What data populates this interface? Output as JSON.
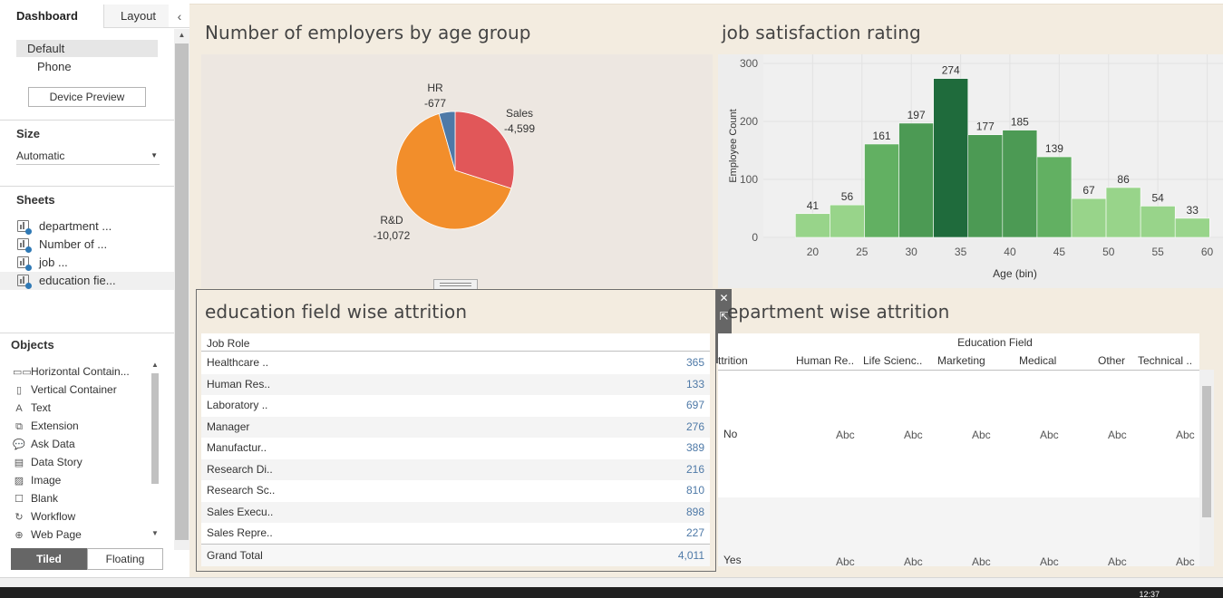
{
  "left_panel": {
    "tabs": [
      "Dashboard",
      "Layout"
    ],
    "collapse_glyph": "‹",
    "devices": {
      "default": "Default",
      "phone": "Phone",
      "preview_button": "Device Preview"
    },
    "size": {
      "title": "Size",
      "value": "Automatic"
    },
    "sheets": {
      "title": "Sheets",
      "items": [
        "department ...",
        "Number of ...",
        "job ...",
        "education fie..."
      ]
    },
    "objects": {
      "title": "Objects",
      "items": [
        {
          "label": "Horizontal Contain...",
          "icon": "horizontal-container-icon",
          "glyph": "▭▭"
        },
        {
          "label": "Vertical Container",
          "icon": "vertical-container-icon",
          "glyph": "▯"
        },
        {
          "label": "Text",
          "icon": "text-icon",
          "glyph": "A"
        },
        {
          "label": "Extension",
          "icon": "extension-icon",
          "glyph": "⧉"
        },
        {
          "label": "Ask Data",
          "icon": "ask-data-icon",
          "glyph": "💬"
        },
        {
          "label": "Data Story",
          "icon": "data-story-icon",
          "glyph": "▤"
        },
        {
          "label": "Image",
          "icon": "image-icon",
          "glyph": "▨"
        },
        {
          "label": "Blank",
          "icon": "blank-icon",
          "glyph": "☐"
        },
        {
          "label": "Workflow",
          "icon": "workflow-icon",
          "glyph": "↻"
        },
        {
          "label": "Web Page",
          "icon": "web-page-icon",
          "glyph": "⊕"
        }
      ]
    },
    "layout_buttons": {
      "tiled": "Tiled",
      "floating": "Floating"
    }
  },
  "dashboard": {
    "pie_title": "Number of employers by age group",
    "hist_title": "job satisfaction rating",
    "edu_title": "education field wise attrition",
    "dept_title": "epartment wise attrition"
  },
  "chart_data": [
    {
      "type": "pie",
      "title": "Number of employers by age group",
      "slices": [
        {
          "label": "Sales",
          "value": -4599,
          "display": "-4,599",
          "color": "#e15759"
        },
        {
          "label": "R&D",
          "value": -10072,
          "display": "-10,072",
          "color": "#f28e2b"
        },
        {
          "label": "HR",
          "value": -677,
          "display": "-677",
          "color": "#4e79a7"
        }
      ]
    },
    {
      "type": "bar",
      "title": "job satisfaction rating",
      "xlabel": "Age (bin)",
      "ylabel": "Employee Count",
      "x_bins": [
        17.5,
        22.5,
        27.5,
        32.5,
        37.5,
        42.5,
        47.5,
        52.5,
        57.5
      ],
      "bin_width": 5,
      "bins": [
        {
          "start": 17.5,
          "value": 41
        },
        {
          "start": 22.5,
          "value": 56
        },
        {
          "start": 25,
          "value": 161
        },
        {
          "start": 27.5,
          "value": 197
        },
        {
          "start": 32.5,
          "value": 274
        },
        {
          "start": 35,
          "value": 177
        },
        {
          "start": 37.5,
          "value": 185
        },
        {
          "start": 42.5,
          "value": 139
        },
        {
          "start": 45,
          "value": 67
        },
        {
          "start": 47.5,
          "value": 86
        },
        {
          "start": 52.5,
          "value": 54
        },
        {
          "start": 55,
          "value": 33
        }
      ],
      "centers": [
        20.0,
        23.5,
        27.0,
        30.5,
        34.0,
        37.5,
        41.0,
        44.5,
        48.0,
        51.5,
        55.0,
        58.5
      ],
      "xticks": [
        20,
        25,
        30,
        35,
        40,
        45,
        50,
        55,
        60
      ],
      "yticks": [
        0,
        100,
        200,
        300
      ],
      "xlim": [
        15,
        60.5
      ],
      "ylim": [
        0,
        300
      ],
      "colors": {
        "max": "#1f6b3c",
        "high": "#4c9a54",
        "mid": "#62b062",
        "low": "#98d48a"
      }
    },
    {
      "type": "table",
      "title": "education field wise attrition",
      "columns": [
        "Job Role",
        ""
      ],
      "rows": [
        [
          "Healthcare ..",
          "365"
        ],
        [
          "Human Res..",
          "133"
        ],
        [
          "Laboratory ..",
          "697"
        ],
        [
          "Manager",
          "276"
        ],
        [
          "Manufactur..",
          "389"
        ],
        [
          "Research Di..",
          "216"
        ],
        [
          "Research Sc..",
          "810"
        ],
        [
          "Sales Execu..",
          "898"
        ],
        [
          "Sales Repre..",
          "227"
        ]
      ],
      "total": [
        "Grand Total",
        "4,011"
      ]
    },
    {
      "type": "table",
      "title": "epartment wise attrition",
      "super_header": "Education Field",
      "row_header": "ttrition",
      "columns": [
        "Human Re..",
        "Life Scienc..",
        "Marketing",
        "Medical",
        "Other",
        "Technical .."
      ],
      "rows": [
        {
          "label": "No",
          "cells": [
            "Abc",
            "Abc",
            "Abc",
            "Abc",
            "Abc",
            "Abc"
          ]
        },
        {
          "label": "Yes",
          "cells": [
            "Abc",
            "Abc",
            "Abc",
            "Abc",
            "Abc",
            "Abc"
          ]
        }
      ]
    }
  ],
  "taskbar": {
    "clock": "12:37"
  }
}
